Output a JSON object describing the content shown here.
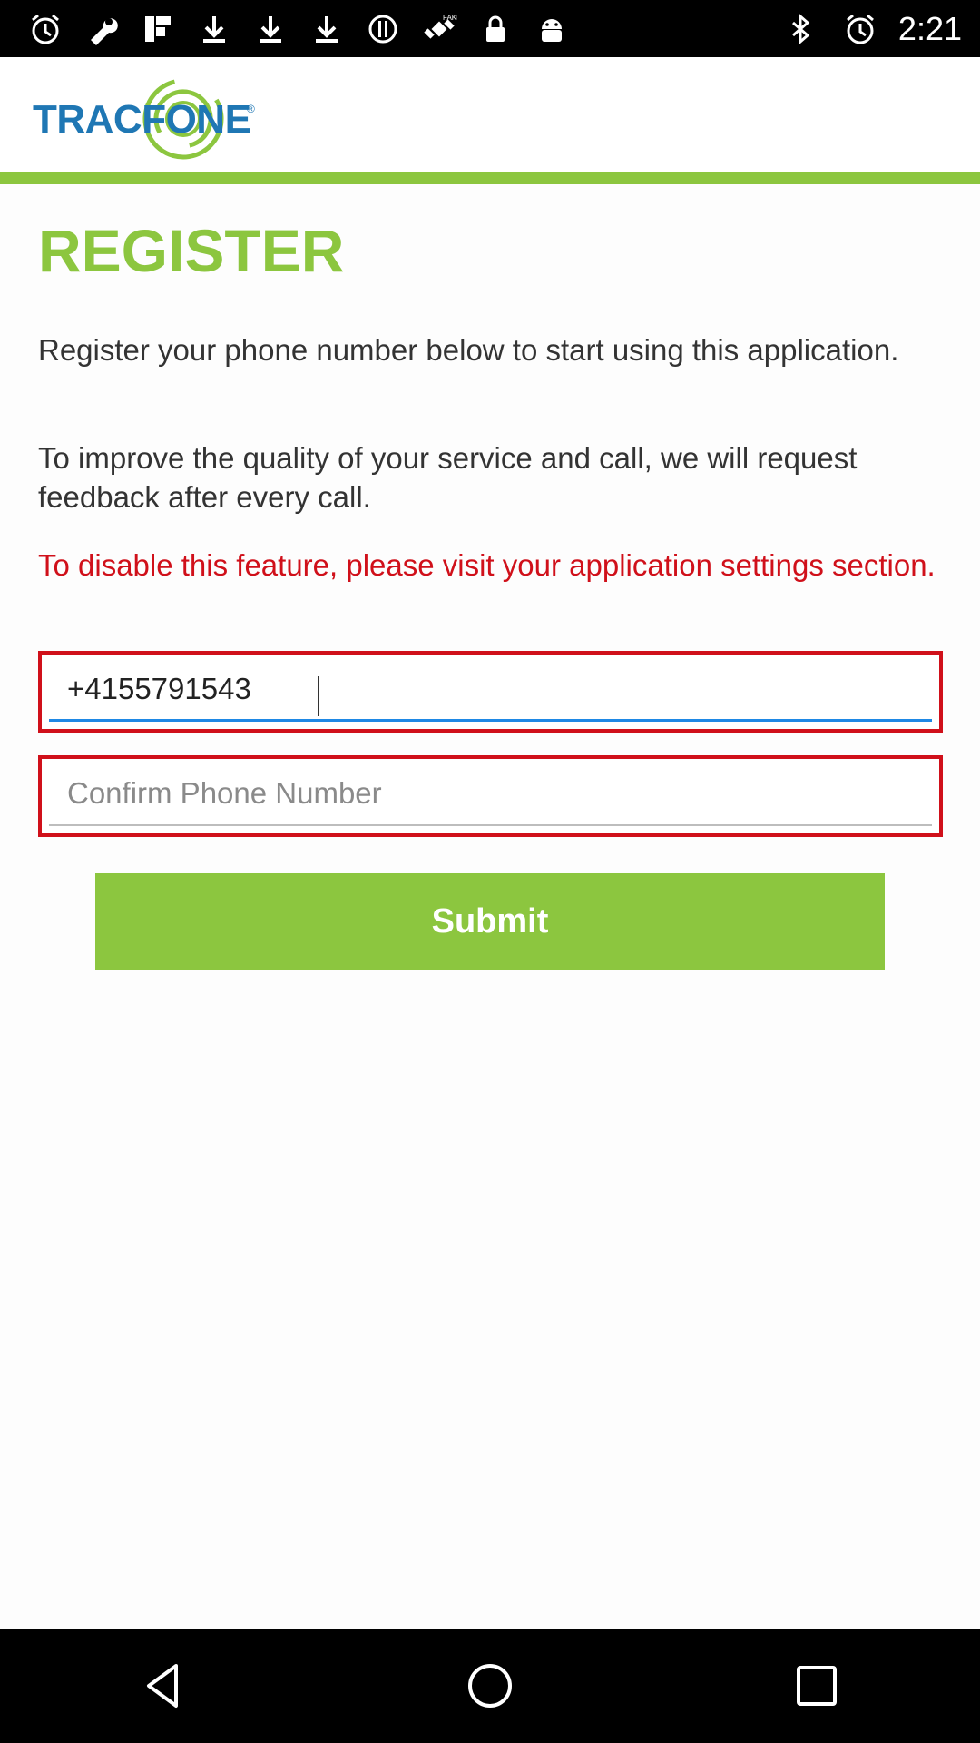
{
  "status_bar": {
    "time": "2:21",
    "left_icons": [
      "alarm-icon",
      "wrench-icon",
      "flipboard-icon",
      "download-icon",
      "download-icon",
      "download-icon",
      "pinned-icon",
      "satellite-icon",
      "lock-icon",
      "android-icon"
    ],
    "right_icons": [
      "bluetooth-icon",
      "alarm-icon"
    ],
    "satellite_badge": "FAKE"
  },
  "header": {
    "logo_text": "TRACFONE",
    "logo_registered": "®",
    "brand_color": "#1f77b4",
    "accent_color": "#8cc63f"
  },
  "main": {
    "title": "REGISTER",
    "paragraph_1": "Register your phone number below to start using this application.",
    "paragraph_2": "To improve the quality of your service and call, we will request feedback after every call.",
    "paragraph_3": "To disable this feature, please visit your application settings section.",
    "warning_color": "#d0101a",
    "phone_field": {
      "value": "+4155791543",
      "placeholder": ""
    },
    "confirm_field": {
      "value": "",
      "placeholder": "Confirm Phone Number"
    },
    "submit_label": "Submit"
  },
  "nav_bar": {
    "buttons": [
      "back-icon",
      "home-icon",
      "recents-icon"
    ]
  }
}
